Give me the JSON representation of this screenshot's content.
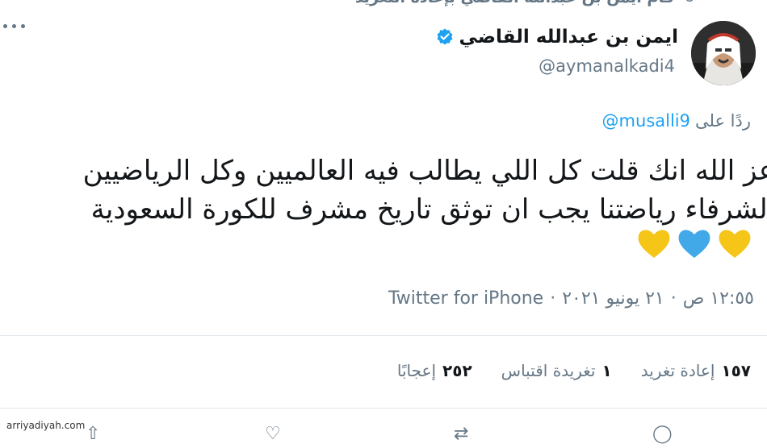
{
  "retweet_header": {
    "text": "قام ايمن بن عبدالله القاضي بإعادة التغريد",
    "icon": "retweet-icon"
  },
  "author": {
    "display_name": "ايمن بن عبدالله القاضي",
    "handle": "@aymanalkadi4",
    "verified": true,
    "verified_color": "#1da1f2"
  },
  "reply": {
    "label": "ردًا على",
    "user": "@musalli9"
  },
  "tweet": {
    "text": "عز الله انك قلت كل اللي يطالب فيه العالميين وكل الرياضيين\nالشرفاء رياضتنا يجب ان توثق تاريخ مشرف للكورة السعودية",
    "emojis": [
      "yellow-heart",
      "blue-heart",
      "yellow-heart"
    ],
    "heart_colors": {
      "yellow": "#f5c518",
      "blue": "#41a9e8"
    }
  },
  "meta": {
    "time": "١٢:٥٥ ص",
    "date": "٢١ يونيو ٢٠٢١",
    "separator": "·",
    "source": "Twitter for iPhone"
  },
  "stats": [
    {
      "count": "١٥٧",
      "label": "إعادة تغريد"
    },
    {
      "count": "١",
      "label": "تغريدة اقتباس"
    },
    {
      "count": "٢٥٢",
      "label": "إعجابًا"
    }
  ],
  "watermark": "arriyadiyah.com",
  "colors": {
    "accent": "#1da1f2",
    "secondary_text": "#657786",
    "divider": "#e1e8ed"
  }
}
